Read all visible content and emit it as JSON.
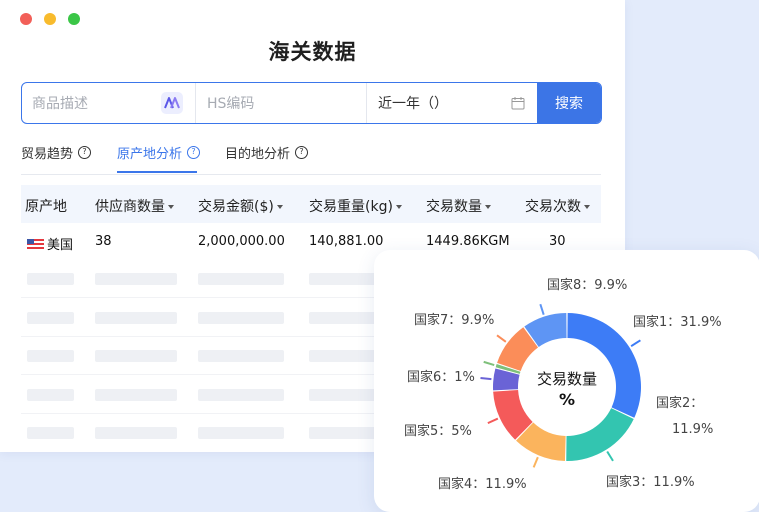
{
  "window": {
    "title": "海关数据",
    "dots": [
      "#f25f58",
      "#f8bb2d",
      "#3bc647"
    ]
  },
  "search": {
    "product_placeholder": "商品描述",
    "hs_placeholder": "HS编码",
    "date_value": "近一年（）",
    "button_label": "搜索"
  },
  "tabs": [
    {
      "label": "贸易趋势",
      "active": false
    },
    {
      "label": "原产地分析",
      "active": true
    },
    {
      "label": "目的地分析",
      "active": false
    }
  ],
  "table": {
    "headers": [
      "原产地",
      "供应商数量",
      "交易金额($)",
      "交易重量(kg)",
      "交易数量",
      "交易次数"
    ],
    "rows": [
      [
        "美国",
        "38",
        "2,000,000.00",
        "140,881.00",
        "1449.86KGM",
        "30"
      ]
    ]
  },
  "chart_data": {
    "type": "pie",
    "donut": true,
    "title": "交易数量",
    "unit": "%",
    "slices": [
      {
        "label": "国家1",
        "value": 31.9,
        "value_label": "31.9%",
        "color": "#3d7cf6"
      },
      {
        "label": "国家2",
        "value": 18.3,
        "value_label": "11.9%",
        "color": "#33c5b0"
      },
      {
        "label": "国家3",
        "value": 11.9,
        "value_label": "11.9%",
        "color": "#fbb45d"
      },
      {
        "label": "国家4",
        "value": 11.9,
        "value_label": "11.9%",
        "color": "#f45a5a"
      },
      {
        "label": "国家5",
        "value": 5,
        "value_label": "5%",
        "color": "#6a63d6"
      },
      {
        "label": "国家6",
        "value": 1,
        "value_label": "1%",
        "color": "#7ec07a"
      },
      {
        "label": "国家7",
        "value": 9.9,
        "value_label": "9.9%",
        "color": "#fb8d59"
      },
      {
        "label": "国家8",
        "value": 9.9,
        "value_label": "9.9%",
        "color": "#5e95f4"
      }
    ]
  }
}
